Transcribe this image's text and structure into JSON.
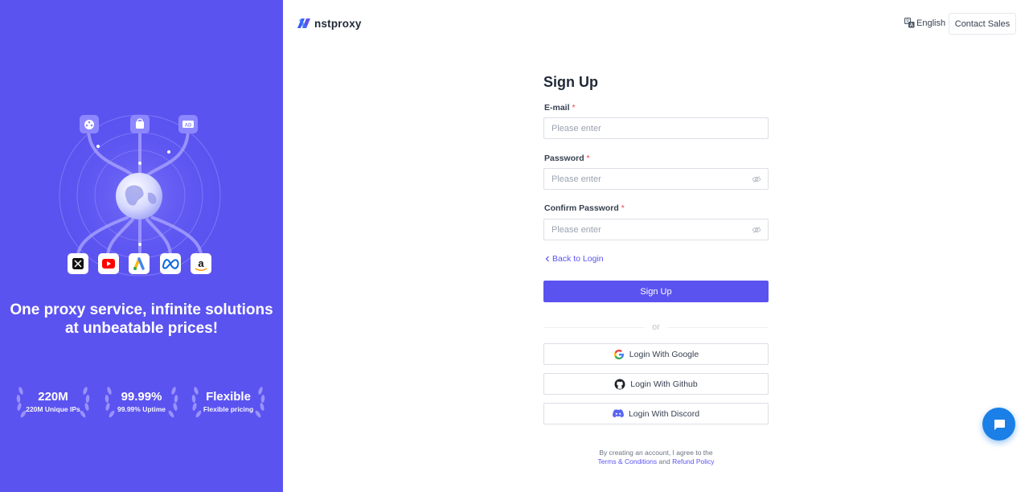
{
  "brand": {
    "name": "nstproxy"
  },
  "header": {
    "language": "English",
    "contact_sales": "Contact Sales"
  },
  "promo": {
    "tagline_line1": "One proxy service, infinite solutions",
    "tagline_line2": "at unbeatable prices!",
    "top_icons": [
      "film-reel-icon",
      "shopping-bag-icon",
      "ad-icon"
    ],
    "app_icons": [
      "x-twitter-icon",
      "youtube-icon",
      "google-ads-icon",
      "meta-icon",
      "amazon-icon"
    ],
    "stats": [
      {
        "value": "220M",
        "label": "220M Unique IPs"
      },
      {
        "value": "99.99%",
        "label": "99.99% Uptime"
      },
      {
        "value": "Flexible",
        "label": "Flexible pricing"
      }
    ]
  },
  "form": {
    "title": "Sign Up",
    "email": {
      "label": "E-mail",
      "required_mark": "*",
      "placeholder": "Please enter"
    },
    "password": {
      "label": "Password",
      "required_mark": "*",
      "placeholder": "Please enter"
    },
    "confirm_password": {
      "label": "Confirm Password",
      "required_mark": "*",
      "placeholder": "Please enter"
    },
    "back_to_login": "Back to Login",
    "submit": "Sign Up",
    "divider": "or",
    "oauth": {
      "google": "Login With Google",
      "github": "Login With Github",
      "discord": "Login With Discord"
    },
    "terms": {
      "prefix": "By creating an account, I agree to the",
      "terms_link": "Terms & Conditions",
      "and": "and",
      "refund_link": "Refund Policy"
    }
  },
  "colors": {
    "primary": "#5b53f0",
    "chat": "#1a7fe6",
    "required": "#ef4444"
  }
}
